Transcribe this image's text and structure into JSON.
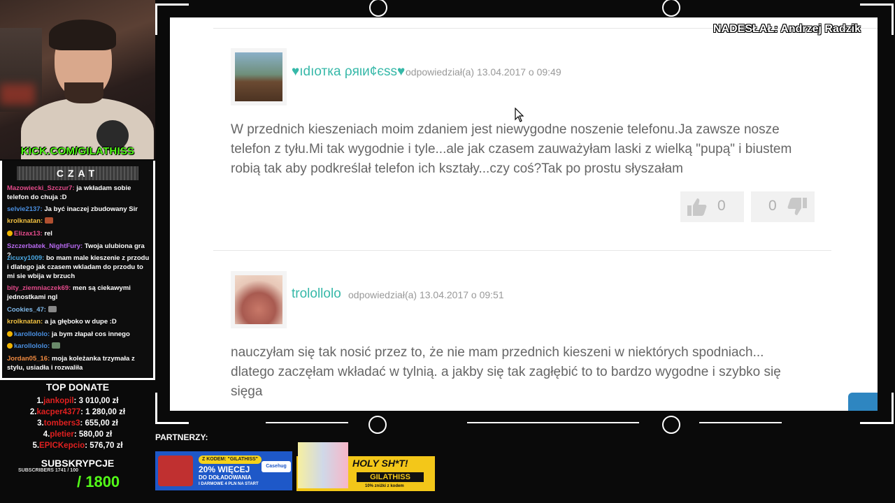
{
  "stream": {
    "channel": "KICK.COM/GILATHISS",
    "chat_title": "CZAT",
    "sender_label": "NADESŁAŁ: Andrzej Radzik",
    "partners_label": "PARTNERZY:"
  },
  "chat": [
    {
      "user": "Mazowiecki_Szczur7:",
      "text": "ja wkładam sobie telefon do chuja :D",
      "color": "#e34a8a"
    },
    {
      "user": "selvie2137:",
      "text": "Ja być inaczej zbudowany Sir",
      "color": "#4a90e2"
    },
    {
      "user": "krolknatan:",
      "text": "",
      "color": "#f0c040"
    },
    {
      "user": "Elizax13:",
      "text": "rel",
      "color": "#e34a8a"
    },
    {
      "user": "Szczerbatek_NightFury:",
      "text": "Twoja ulubiona gra ?",
      "color": "#b86af0"
    },
    {
      "user": "zicuxy1009:",
      "text": "bo mam male kieszenie z przodu i dlatego jak czasem wkladam do przodu to mi sie wbija w brzuch",
      "color": "#4aa8e2"
    },
    {
      "user": "bity_ziemniaczek69:",
      "text": "men są ciekawymi jednostkami ngl",
      "color": "#e34a8a"
    },
    {
      "user": "Cookies_47:",
      "text": "",
      "color": "#7fb8e8"
    },
    {
      "user": "krolknatan:",
      "text": "a ja głęboko w dupe :D",
      "color": "#f0c040"
    },
    {
      "user": "karollololo:",
      "text": "ja bym złapał cos innego",
      "color": "#4a90e2"
    },
    {
      "user": "karollololo:",
      "text": "",
      "color": "#4a90e2"
    },
    {
      "user": "Jordan05_16:",
      "text": "moja koleżanka trzymała z stylu, usiadła i rozwaliła",
      "color": "#f08a40"
    }
  ],
  "donate": {
    "title": "TOP DONATE",
    "rows": [
      {
        "rank": "1.",
        "name": "jankopil",
        "amount": ": 3 010,00 zł"
      },
      {
        "rank": "2.",
        "name": "kacper4377",
        "amount": ": 1 280,00 zł"
      },
      {
        "rank": "3.",
        "name": "tombers3",
        "amount": ": 655,00 zł"
      },
      {
        "rank": "4.",
        "name": "pletier",
        "amount": ": 580,00 zł"
      },
      {
        "rank": "5.",
        "name": "EPICKepcio",
        "amount": ": 576,70 zł"
      }
    ]
  },
  "subs": {
    "title": "SUBSKRYPCJE",
    "small": "SUBSCRIBERS 1741 / 100",
    "goal": "/ 1800"
  },
  "comments": [
    {
      "username": "♥ıdıотка ρяιи¢єѕѕ♥",
      "meta": "odpowiedział(a) 13.04.2017 o 09:49",
      "text": "W przednich kieszeniach moim zdaniem jest niewygodne noszenie telefonu.Ja zawsze nosze telefon z tyłu.Mi tak wygodnie i tyle...ale jak czasem zauważyłam laski z wielką \"pupą\" i biustem robią tak aby podkreślał telefon ich kształy...czy coś?Tak po prostu słyszałam",
      "likes": "0",
      "dislikes": "0"
    },
    {
      "username": "trolollolo",
      "meta": "odpowiedział(a) 13.04.2017 o 09:51",
      "text": "nauczyłam się tak nosić przez to, że nie mam przednich kieszeni w niektórych spodniach... dlatego zaczęłam wkładać w tylnią. a jakby się tak zagłębić to to bardzo wygodne i szybko się sięga"
    }
  ],
  "ads": {
    "ad1": {
      "code": "Z KODEM: \"GILATHISS\"",
      "big": "20% WIĘCEJ",
      "mid": "DO DOŁADOWANIA",
      "small": "I DARMOWE 4 PLN NA START",
      "brand": "Casehug"
    },
    "ad2": {
      "title": "HOLY SH*T!",
      "code": "GILATHISS",
      "small": "10% zniżki z kodem"
    }
  },
  "colors": {
    "kick_green": "#53fc18",
    "username_teal": "#36b8a8",
    "donor_red": "#e02020"
  }
}
